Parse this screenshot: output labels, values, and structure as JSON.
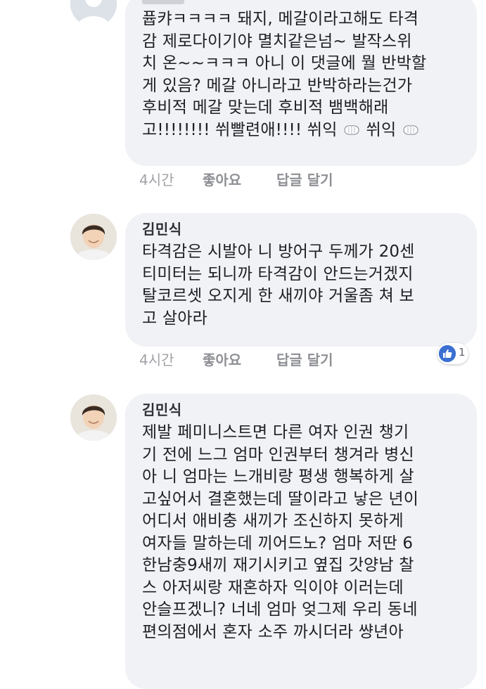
{
  "colors": {
    "bubble_bg": "#f1f2f6",
    "action_text": "#8e9095",
    "like_badge": "#3b6fd1"
  },
  "comments": [
    {
      "author": "",
      "text_lines": [
        "퓹캬ㅋㅋㅋㅋ 돼지, 메갈이라고해도 타격",
        "감 제로다이기야 멸치같은넘~ 발작스위",
        "치 온~~ㅋㅋㅋ 아니 이 댓글에 뭘 반박할",
        "게 있음? 메갈 아니라고 반박하라는건가",
        "후비적 메갈 맞는데 후비적 뱀백해래",
        "고!!!!!!!! 쒸빨련애!!!! 쒸익",
        "쒸익"
      ],
      "time": "4시간",
      "like_label": "좋아요",
      "reply_label": "답글 달기"
    },
    {
      "author": "김민식",
      "text_lines": [
        "타격감은 시발아 니 방어구 두께가 20센",
        "티미터는 되니까 타격감이 안드는거겠지",
        "탈코르셋 오지게 한 새끼야 거울좀 쳐 보",
        "고 살아라"
      ],
      "time": "4시간",
      "like_label": "좋아요",
      "reply_label": "답글 달기",
      "reaction_count": "1",
      "reaction_icon": "thumbs-up-icon"
    },
    {
      "author": "김민식",
      "text_lines": [
        "제발 페미니스트면 다른 여자 인권 챙기",
        "기 전에 느그 엄마 인권부터 챙겨라 병신",
        "아 니 엄마는 느개비랑 평생 행복하게 살",
        "고싶어서 결혼했는데 딸이라고 낳은 년이",
        "어디서 애비충 새끼가 조신하지 못하게",
        "여자들 말하는데 끼어드노? 엄마 저딴 6",
        "한남충9새끼 재기시키고 옆집 갓양남 찰",
        "스 아저씨랑 재혼하자 익이야 이러는데",
        "안슬프겠니? 너네 엄마 엊그제 우리 동네",
        "편의점에서 혼자 소주 까시더라 썅년아"
      ]
    }
  ]
}
